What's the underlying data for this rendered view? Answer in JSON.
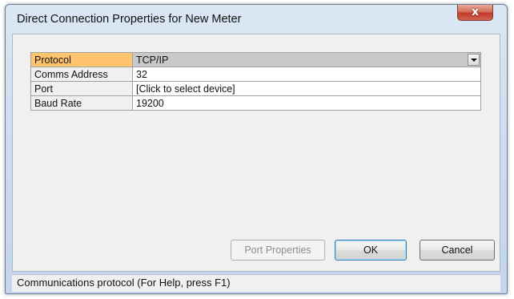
{
  "window": {
    "title": "Direct Connection Properties for New Meter",
    "close_label": "x"
  },
  "properties": [
    {
      "label": "Protocol",
      "value": "TCP/IP"
    },
    {
      "label": "Comms Address",
      "value": "32"
    },
    {
      "label": "Port",
      "value": "[Click to select device]"
    },
    {
      "label": "Baud Rate",
      "value": "19200"
    }
  ],
  "buttons": {
    "port_properties": "Port Properties",
    "ok": "OK",
    "cancel": "Cancel"
  },
  "status_bar": "Communications protocol (For Help, press F1)",
  "colors": {
    "selected_label": "#ffc56e",
    "selected_value": "#c8c8c8",
    "close_button": "#c0392b"
  }
}
